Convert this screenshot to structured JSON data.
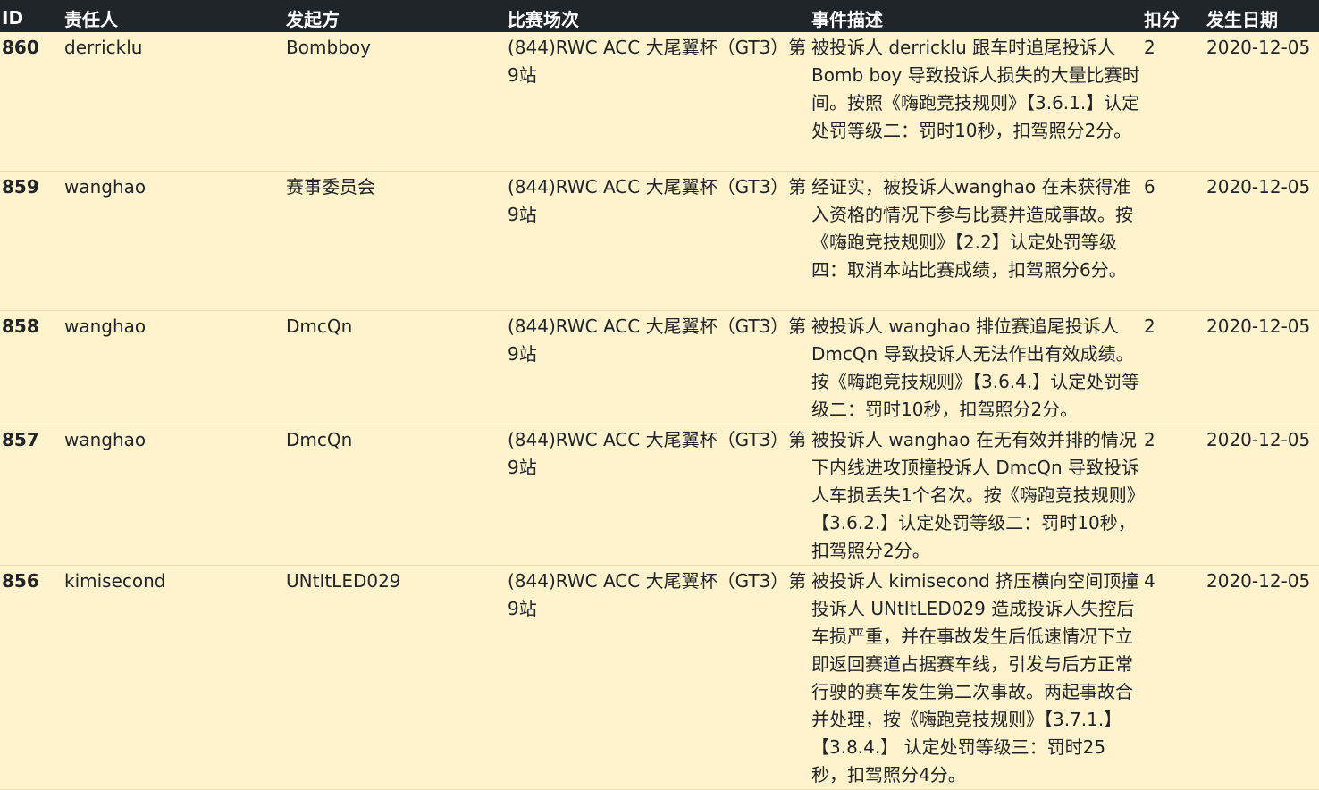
{
  "table": {
    "headers": {
      "id": "ID",
      "responsible": "责任人",
      "initiator": "发起方",
      "race": "比赛场次",
      "description": "事件描述",
      "points": "扣分",
      "date": "发生日期"
    },
    "rows": [
      {
        "id": "860",
        "responsible": "derricklu",
        "initiator": "Bombboy",
        "race": "(844)RWC ACC 大尾翼杯（GT3）第9站",
        "description": "被投诉人 derricklu 跟车时追尾投诉人 Bomb boy 导致投诉人损失的大量比赛时间。按照《嗨跑竞技规则》【3.6.1.】认定处罚等级二：罚时10秒，扣驾照分2分。",
        "points": "2",
        "date": "2020-12-05"
      },
      {
        "id": "859",
        "responsible": "wanghao",
        "initiator": "赛事委员会",
        "race": "(844)RWC ACC 大尾翼杯（GT3）第9站",
        "description": "经证实，被投诉人wanghao 在未获得准入资格的情况下参与比赛并造成事故。按《嗨跑竞技规则》【2.2】认定处罚等级四：取消本站比赛成绩，扣驾照分6分。",
        "points": "6",
        "date": "2020-12-05"
      },
      {
        "id": "858",
        "responsible": "wanghao",
        "initiator": "DmcQn",
        "race": "(844)RWC ACC 大尾翼杯（GT3）第9站",
        "description": "被投诉人 wanghao 排位赛追尾投诉人 DmcQn 导致投诉人无法作出有效成绩。按《嗨跑竞技规则》【3.6.4.】认定处罚等级二：罚时10秒，扣驾照分2分。",
        "points": "2",
        "date": "2020-12-05"
      },
      {
        "id": "857",
        "responsible": "wanghao",
        "initiator": "DmcQn",
        "race": "(844)RWC ACC 大尾翼杯（GT3）第9站",
        "description": "被投诉人 wanghao 在无有效并排的情况下内线进攻顶撞投诉人 DmcQn 导致投诉人车损丢失1个名次。按《嗨跑竞技规则》【3.6.2.】认定处罚等级二：罚时10秒，扣驾照分2分。",
        "points": "2",
        "date": "2020-12-05"
      },
      {
        "id": "856",
        "responsible": "kimisecond",
        "initiator": "UNtItLED029",
        "race": "(844)RWC ACC 大尾翼杯（GT3）第9站",
        "description": "被投诉人 kimisecond 挤压横向空间顶撞投诉人 UNtItLED029 造成投诉人失控后车损严重，并在事故发生后低速情况下立即返回赛道占据赛车线，引发与后方正常行驶的赛车发生第二次事故。两起事故合并处理，按《嗨跑竞技规则》【3.7.1.】【3.8.4.】 认定处罚等级三：罚时25秒，扣驾照分4分。",
        "points": "4",
        "date": "2020-12-05"
      }
    ]
  }
}
